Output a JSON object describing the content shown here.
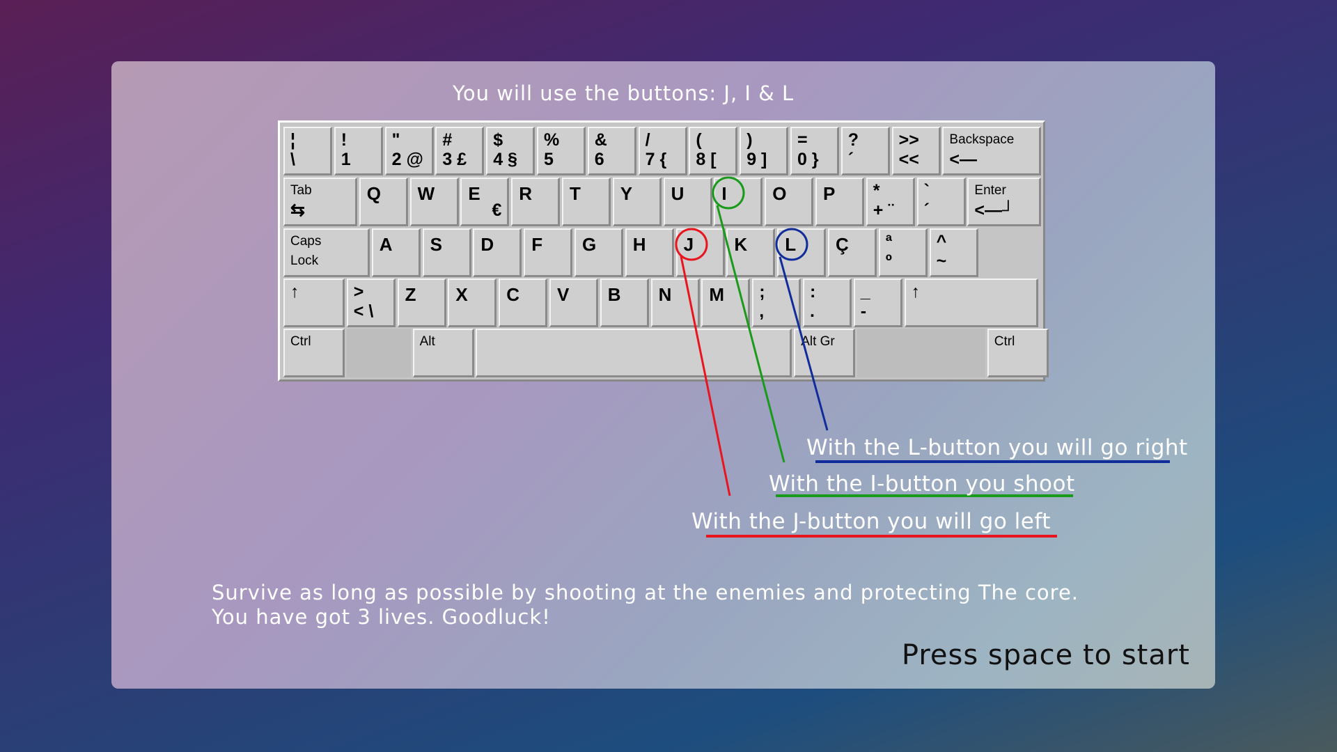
{
  "title": "You will use the buttons: J, I & L",
  "keyboard": {
    "row1": [
      {
        "top": "¦",
        "bot": "\\"
      },
      {
        "top": "!",
        "bot": "1"
      },
      {
        "top": "\"",
        "bot": "2 @"
      },
      {
        "top": "#",
        "bot": "3 £"
      },
      {
        "top": "$",
        "bot": "4 §"
      },
      {
        "top": "%",
        "bot": "5"
      },
      {
        "top": "&",
        "bot": "6"
      },
      {
        "top": "/",
        "bot": "7 {"
      },
      {
        "top": "(",
        "bot": "8 ["
      },
      {
        "top": ")",
        "bot": "9 ]"
      },
      {
        "top": "=",
        "bot": "0 }"
      },
      {
        "top": "?",
        "bot": "´"
      },
      {
        "top": ">>",
        "bot": "<<"
      },
      {
        "top": "Backspace",
        "bot": "<—"
      }
    ],
    "row2": [
      {
        "top": "Tab",
        "bot": "⇆"
      },
      {
        "letter": "Q"
      },
      {
        "letter": "W"
      },
      {
        "letter": "E",
        "br": "€"
      },
      {
        "letter": "R"
      },
      {
        "letter": "T"
      },
      {
        "letter": "Y"
      },
      {
        "letter": "U"
      },
      {
        "letter": "I"
      },
      {
        "letter": "O"
      },
      {
        "letter": "P"
      },
      {
        "top": "*",
        "bot": "+ ¨"
      },
      {
        "top": "`",
        "bot": "´"
      },
      {
        "top": "Enter",
        "bot": "<—┘"
      }
    ],
    "row3": [
      {
        "top": "Caps",
        "bot": "Lock"
      },
      {
        "letter": "A"
      },
      {
        "letter": "S"
      },
      {
        "letter": "D"
      },
      {
        "letter": "F"
      },
      {
        "letter": "G"
      },
      {
        "letter": "H"
      },
      {
        "letter": "J"
      },
      {
        "letter": "K"
      },
      {
        "letter": "L"
      },
      {
        "letter": "Ç"
      },
      {
        "top": "ª",
        "bot": "º"
      },
      {
        "top": "^",
        "bot": "~"
      }
    ],
    "row4": [
      {
        "top": "↑"
      },
      {
        "top": ">",
        "bot": "< \\"
      },
      {
        "letter": "Z"
      },
      {
        "letter": "X"
      },
      {
        "letter": "C"
      },
      {
        "letter": "V"
      },
      {
        "letter": "B"
      },
      {
        "letter": "N"
      },
      {
        "letter": "M"
      },
      {
        "top": ";",
        "bot": ","
      },
      {
        "top": ":",
        "bot": "."
      },
      {
        "top": "_",
        "bot": "-"
      },
      {
        "top": "↑"
      }
    ],
    "row5": [
      {
        "top": "Ctrl"
      },
      {
        "blank": true
      },
      {
        "top": "Alt"
      },
      {
        "top": ""
      },
      {
        "top": "Alt Gr"
      },
      {
        "blank": true
      },
      {
        "top": "Ctrl"
      }
    ]
  },
  "highlights": [
    {
      "key": "J",
      "color": "#e8141e"
    },
    {
      "key": "I",
      "color": "#1a9a1a"
    },
    {
      "key": "L",
      "color": "#102c9a"
    }
  ],
  "captions": {
    "l": "With the L-button you will go right",
    "i": "With the I-button you shoot",
    "j": "With the J-button you will go left"
  },
  "description": {
    "line1": "Survive as long as possible by shooting at the enemies and protecting The core.",
    "line2": "You have got 3 lives. Goodluck!"
  },
  "start_prompt": "Press space to start"
}
